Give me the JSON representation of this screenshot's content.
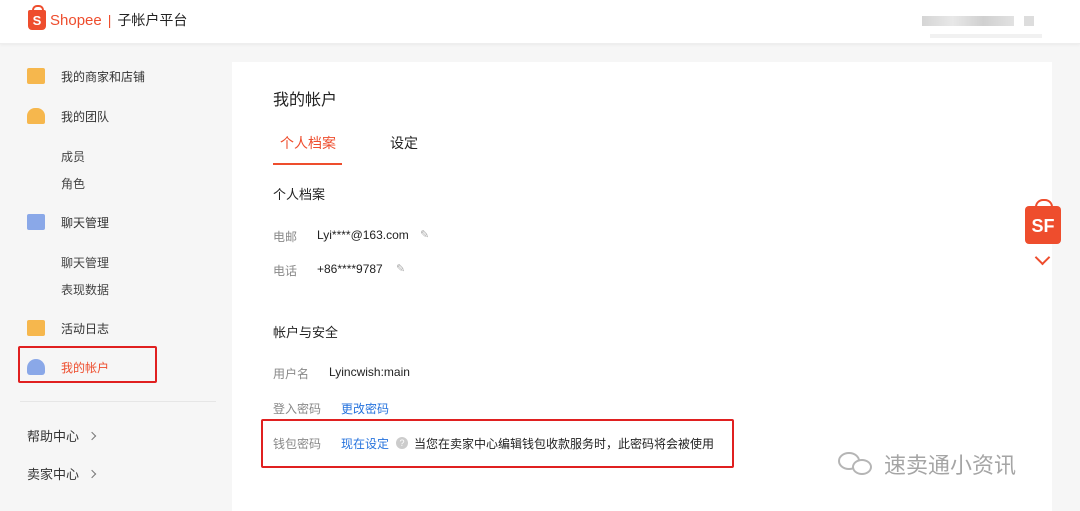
{
  "header": {
    "logo_letter": "S",
    "brand": "Shopee",
    "separator": "|",
    "platform": "子帐户平台"
  },
  "sidebar": {
    "items": [
      {
        "label": "我的商家和店铺",
        "icon": "store-icon"
      },
      {
        "label": "我的团队",
        "icon": "team-icon"
      },
      {
        "label": "成员"
      },
      {
        "label": "角色"
      },
      {
        "label": "聊天管理",
        "icon": "chat-icon"
      },
      {
        "label": "聊天管理"
      },
      {
        "label": "表现数据"
      },
      {
        "label": "活动日志",
        "icon": "log-icon"
      },
      {
        "label": "我的帐户",
        "icon": "account-icon",
        "active": true
      }
    ],
    "help_center": "帮助中心",
    "seller_center": "卖家中心"
  },
  "main": {
    "title": "我的帐户",
    "tabs": [
      "个人档案",
      "设定"
    ],
    "profile_section": "个人档案",
    "email_label": "电邮",
    "email_value": "Lyi****@163.com",
    "phone_label": "电话",
    "phone_value": "+86****9787",
    "security_section": "帐户与安全",
    "username_label": "用户名",
    "username_value": "Lyincwish:main",
    "login_pwd_label": "登入密码",
    "login_pwd_link": "更改密码",
    "wallet_pwd_label": "钱包密码",
    "wallet_pwd_link": "现在设定",
    "wallet_help_icon": "?",
    "wallet_hint": "当您在卖家中心编辑钱包收款服务时，此密码将会被使用"
  },
  "floating": {
    "badge": "SF"
  },
  "watermark": {
    "text": "速卖通小资讯"
  },
  "colors": {
    "brand": "#ee4d2d",
    "link": "#2673dd",
    "highlight": "#e02020"
  }
}
